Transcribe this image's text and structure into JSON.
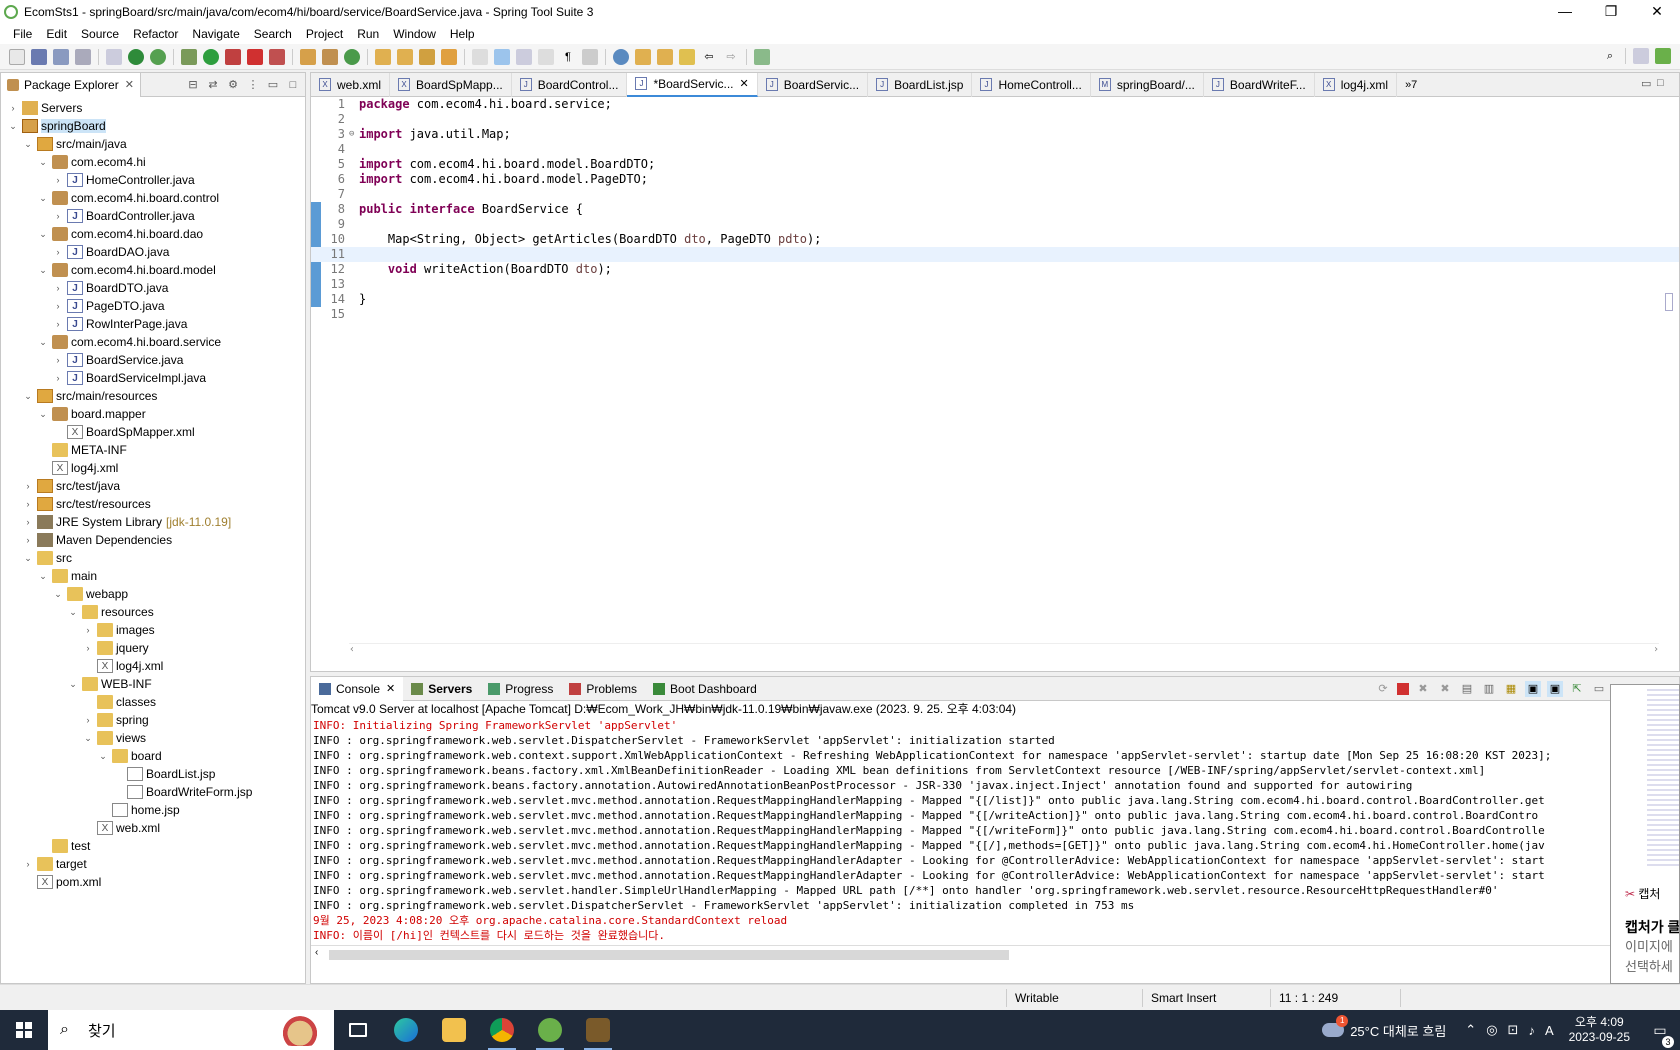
{
  "window": {
    "title": "EcomSts1 - springBoard/src/main/java/com/ecom4/hi/board/service/BoardService.java - Spring Tool Suite 3",
    "minimize": "—",
    "restore": "❐",
    "close": "✕"
  },
  "menu": [
    "File",
    "Edit",
    "Source",
    "Refactor",
    "Navigate",
    "Search",
    "Project",
    "Run",
    "Window",
    "Help"
  ],
  "explorer": {
    "tab_label": "Package Explorer",
    "rows": [
      {
        "label": "Servers",
        "level": 0,
        "twisty": "›",
        "icon": "server"
      },
      {
        "label": "springBoard",
        "level": 0,
        "twisty": "⌄",
        "icon": "proj",
        "selected": true
      },
      {
        "label": "src/main/java",
        "level": 1,
        "twisty": "⌄",
        "icon": "srcfolder"
      },
      {
        "label": "com.ecom4.hi",
        "level": 2,
        "twisty": "⌄",
        "icon": "pkg"
      },
      {
        "label": "HomeController.java",
        "level": 3,
        "twisty": "›",
        "icon": "java"
      },
      {
        "label": "com.ecom4.hi.board.control",
        "level": 2,
        "twisty": "⌄",
        "icon": "pkg"
      },
      {
        "label": "BoardController.java",
        "level": 3,
        "twisty": "›",
        "icon": "java"
      },
      {
        "label": "com.ecom4.hi.board.dao",
        "level": 2,
        "twisty": "⌄",
        "icon": "pkg"
      },
      {
        "label": "BoardDAO.java",
        "level": 3,
        "twisty": "›",
        "icon": "java"
      },
      {
        "label": "com.ecom4.hi.board.model",
        "level": 2,
        "twisty": "⌄",
        "icon": "pkg"
      },
      {
        "label": "BoardDTO.java",
        "level": 3,
        "twisty": "›",
        "icon": "java"
      },
      {
        "label": "PageDTO.java",
        "level": 3,
        "twisty": "›",
        "icon": "java"
      },
      {
        "label": "RowInterPage.java",
        "level": 3,
        "twisty": "›",
        "icon": "java"
      },
      {
        "label": "com.ecom4.hi.board.service",
        "level": 2,
        "twisty": "⌄",
        "icon": "pkg"
      },
      {
        "label": "BoardService.java",
        "level": 3,
        "twisty": "›",
        "icon": "java"
      },
      {
        "label": "BoardServiceImpl.java",
        "level": 3,
        "twisty": "›",
        "icon": "java"
      },
      {
        "label": "src/main/resources",
        "level": 1,
        "twisty": "⌄",
        "icon": "srcfolder"
      },
      {
        "label": "board.mapper",
        "level": 2,
        "twisty": "⌄",
        "icon": "pkg"
      },
      {
        "label": "BoardSpMapper.xml",
        "level": 3,
        "twisty": "",
        "icon": "xml"
      },
      {
        "label": "META-INF",
        "level": 2,
        "twisty": "",
        "icon": "folder"
      },
      {
        "label": "log4j.xml",
        "level": 2,
        "twisty": "",
        "icon": "xml"
      },
      {
        "label": "src/test/java",
        "level": 1,
        "twisty": "›",
        "icon": "srcfolder"
      },
      {
        "label": "src/test/resources",
        "level": 1,
        "twisty": "›",
        "icon": "srcfolder"
      },
      {
        "label": "JRE System Library",
        "deco": "[jdk-11.0.19]",
        "level": 1,
        "twisty": "›",
        "icon": "lib"
      },
      {
        "label": "Maven Dependencies",
        "level": 1,
        "twisty": "›",
        "icon": "lib"
      },
      {
        "label": "src",
        "level": 1,
        "twisty": "⌄",
        "icon": "folder"
      },
      {
        "label": "main",
        "level": 2,
        "twisty": "⌄",
        "icon": "folder"
      },
      {
        "label": "webapp",
        "level": 3,
        "twisty": "⌄",
        "icon": "folder"
      },
      {
        "label": "resources",
        "level": 4,
        "twisty": "⌄",
        "icon": "folder"
      },
      {
        "label": "images",
        "level": 5,
        "twisty": "›",
        "icon": "folder"
      },
      {
        "label": "jquery",
        "level": 5,
        "twisty": "›",
        "icon": "folder"
      },
      {
        "label": "log4j.xml",
        "level": 5,
        "twisty": "",
        "icon": "xml"
      },
      {
        "label": "WEB-INF",
        "level": 4,
        "twisty": "⌄",
        "icon": "folder"
      },
      {
        "label": "classes",
        "level": 5,
        "twisty": "",
        "icon": "folder"
      },
      {
        "label": "spring",
        "level": 5,
        "twisty": "›",
        "icon": "folder"
      },
      {
        "label": "views",
        "level": 5,
        "twisty": "⌄",
        "icon": "folder"
      },
      {
        "label": "board",
        "level": 6,
        "twisty": "⌄",
        "icon": "folder"
      },
      {
        "label": "BoardList.jsp",
        "level": 7,
        "twisty": "",
        "icon": "jsp"
      },
      {
        "label": "BoardWriteForm.jsp",
        "level": 7,
        "twisty": "",
        "icon": "jsp"
      },
      {
        "label": "home.jsp",
        "level": 6,
        "twisty": "",
        "icon": "jsp"
      },
      {
        "label": "web.xml",
        "level": 5,
        "twisty": "",
        "icon": "xml"
      },
      {
        "label": "test",
        "level": 2,
        "twisty": "",
        "icon": "folder"
      },
      {
        "label": "target",
        "level": 1,
        "twisty": "›",
        "icon": "folder"
      },
      {
        "label": "pom.xml",
        "level": 1,
        "twisty": "",
        "icon": "xml"
      }
    ]
  },
  "editor": {
    "tabs": [
      {
        "label": "web.xml",
        "icon": "X"
      },
      {
        "label": "BoardSpMapp...",
        "icon": "X"
      },
      {
        "label": "BoardControl...",
        "icon": "J"
      },
      {
        "label": "*BoardServic...",
        "icon": "J",
        "active": true
      },
      {
        "label": "BoardServic...",
        "icon": "J"
      },
      {
        "label": "BoardList.jsp",
        "icon": "J"
      },
      {
        "label": "HomeControll...",
        "icon": "J"
      },
      {
        "label": "springBoard/...",
        "icon": "M"
      },
      {
        "label": "BoardWriteF...",
        "icon": "J"
      },
      {
        "label": "log4j.xml",
        "icon": "X"
      }
    ],
    "overflow": "»7",
    "lines": [
      {
        "n": "1",
        "fold": "",
        "parts": [
          [
            "kw",
            "package"
          ],
          [
            "",
            " com.ecom4.hi.board.service;"
          ]
        ]
      },
      {
        "n": "2",
        "fold": "",
        "parts": []
      },
      {
        "n": "3",
        "fold": "⊖",
        "parts": [
          [
            "kw",
            "import"
          ],
          [
            "",
            " java.util.Map;"
          ]
        ]
      },
      {
        "n": "4",
        "fold": "",
        "parts": []
      },
      {
        "n": "5",
        "fold": "",
        "parts": [
          [
            "kw",
            "import"
          ],
          [
            "",
            " com.ecom4.hi.board.model.BoardDTO;"
          ]
        ]
      },
      {
        "n": "6",
        "fold": "",
        "parts": [
          [
            "kw",
            "import"
          ],
          [
            "",
            " com.ecom4.hi.board.model.PageDTO;"
          ]
        ]
      },
      {
        "n": "7",
        "fold": "",
        "parts": []
      },
      {
        "n": "8",
        "fold": "",
        "parts": [
          [
            "kw",
            "public"
          ],
          [
            "",
            " "
          ],
          [
            "kw",
            "interface"
          ],
          [
            "",
            " BoardService {"
          ]
        ]
      },
      {
        "n": "9",
        "fold": "",
        "parts": []
      },
      {
        "n": "10",
        "fold": "",
        "parts": [
          [
            "",
            "    Map<String, Object> getArticles(BoardDTO "
          ],
          [
            "param",
            "dto"
          ],
          [
            "",
            ", PageDTO "
          ],
          [
            "param",
            "pdto"
          ],
          [
            "",
            ");"
          ]
        ]
      },
      {
        "n": "11",
        "fold": "",
        "parts": [],
        "current": true
      },
      {
        "n": "12",
        "fold": "",
        "parts": [
          [
            "",
            "    "
          ],
          [
            "kw",
            "void"
          ],
          [
            "",
            " writeAction(BoardDTO "
          ],
          [
            "param",
            "dto"
          ],
          [
            "",
            ");"
          ]
        ]
      },
      {
        "n": "13",
        "fold": "",
        "parts": []
      },
      {
        "n": "14",
        "fold": "",
        "parts": [
          [
            "",
            "}"
          ]
        ]
      },
      {
        "n": "15",
        "fold": "",
        "parts": []
      }
    ]
  },
  "console": {
    "tabs": [
      {
        "label": "Console",
        "closable": true,
        "active": true,
        "color": "#4a6a9a"
      },
      {
        "label": "Servers",
        "bold": true,
        "color": "#6a8a4a"
      },
      {
        "label": "Progress",
        "color": "#4a9a6a"
      },
      {
        "label": "Problems",
        "color": "#c04040"
      },
      {
        "label": "Boot Dashboard",
        "color": "#3a8a3a"
      }
    ],
    "header": "Tomcat v9.0 Server at localhost [Apache Tomcat] D:₩Ecom_Work_JH₩bin₩jdk-11.0.19₩bin₩javaw.exe  (2023. 9. 25. 오후 4:03:04)",
    "lines": [
      {
        "text": "INFO: Initializing Spring FrameworkServlet 'appServlet'",
        "err": true
      },
      {
        "text": "INFO : org.springframework.web.servlet.DispatcherServlet - FrameworkServlet 'appServlet': initialization started",
        "err": false
      },
      {
        "text": "INFO : org.springframework.web.context.support.XmlWebApplicationContext - Refreshing WebApplicationContext for namespace 'appServlet-servlet': startup date [Mon Sep 25 16:08:20 KST 2023];",
        "err": false
      },
      {
        "text": "INFO : org.springframework.beans.factory.xml.XmlBeanDefinitionReader - Loading XML bean definitions from ServletContext resource [/WEB-INF/spring/appServlet/servlet-context.xml]",
        "err": false
      },
      {
        "text": "INFO : org.springframework.beans.factory.annotation.AutowiredAnnotationBeanPostProcessor - JSR-330 'javax.inject.Inject' annotation found and supported for autowiring",
        "err": false
      },
      {
        "text": "INFO : org.springframework.web.servlet.mvc.method.annotation.RequestMappingHandlerMapping - Mapped \"{[/list]}\" onto public java.lang.String com.ecom4.hi.board.control.BoardController.get",
        "err": false
      },
      {
        "text": "INFO : org.springframework.web.servlet.mvc.method.annotation.RequestMappingHandlerMapping - Mapped \"{[/writeAction]}\" onto public java.lang.String com.ecom4.hi.board.control.BoardContro",
        "err": false
      },
      {
        "text": "INFO : org.springframework.web.servlet.mvc.method.annotation.RequestMappingHandlerMapping - Mapped \"{[/writeForm]}\" onto public java.lang.String com.ecom4.hi.board.control.BoardControlle",
        "err": false
      },
      {
        "text": "INFO : org.springframework.web.servlet.mvc.method.annotation.RequestMappingHandlerMapping - Mapped \"{[/],methods=[GET]}\" onto public java.lang.String com.ecom4.hi.HomeController.home(jav",
        "err": false
      },
      {
        "text": "INFO : org.springframework.web.servlet.mvc.method.annotation.RequestMappingHandlerAdapter - Looking for @ControllerAdvice: WebApplicationContext for namespace 'appServlet-servlet': start",
        "err": false
      },
      {
        "text": "INFO : org.springframework.web.servlet.mvc.method.annotation.RequestMappingHandlerAdapter - Looking for @ControllerAdvice: WebApplicationContext for namespace 'appServlet-servlet': start",
        "err": false
      },
      {
        "text": "INFO : org.springframework.web.servlet.handler.SimpleUrlHandlerMapping - Mapped URL path [/**] onto handler 'org.springframework.web.servlet.resource.ResourceHttpRequestHandler#0'",
        "err": false
      },
      {
        "text": "INFO : org.springframework.web.servlet.DispatcherServlet - FrameworkServlet 'appServlet': initialization completed in 753 ms",
        "err": false
      },
      {
        "text": "9월 25, 2023 4:08:20 오후 org.apache.catalina.core.StandardContext reload",
        "err": true
      },
      {
        "text": "INFO: 이름이 [/hi]인 컨텍스트를 다시 로드하는 것을 완료했습니다.",
        "err": true
      }
    ]
  },
  "status": {
    "writable": "Writable",
    "insert_mode": "Smart Insert",
    "position": "11 : 1 : 249"
  },
  "capture_popup": {
    "title": "캡처",
    "line1": "캡처가 클",
    "line2": "이미지에",
    "line3": "선택하세"
  },
  "taskbar": {
    "search_placeholder": "찾기",
    "weather": "25°C  대체로 흐림",
    "weather_badge": "1",
    "ime": "A",
    "time": "오후 4:09",
    "date": "2023-09-25",
    "notifications": "3"
  }
}
